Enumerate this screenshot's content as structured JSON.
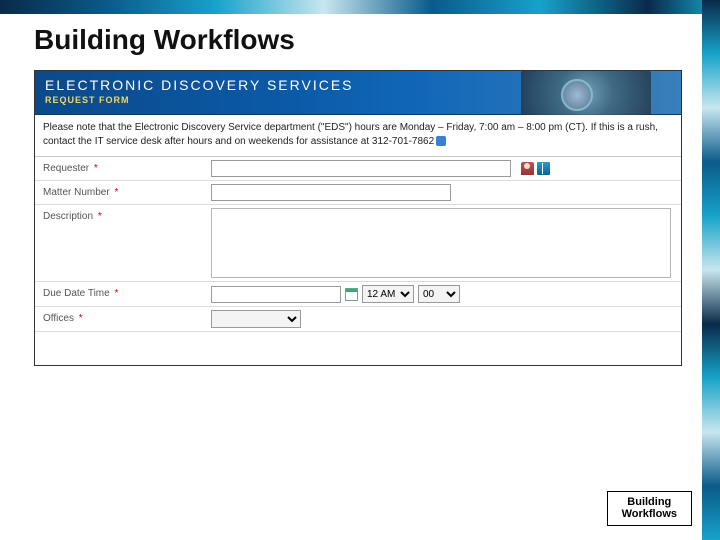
{
  "slide": {
    "title": "Building Workflows",
    "footer_label": "Building\nWorkflows"
  },
  "banner": {
    "title": "ELECTRONIC DISCOVERY SERVICES",
    "subtitle": "REQUEST FORM"
  },
  "notice": {
    "text": "Please note that the Electronic Discovery Service department (\"EDS\") hours are Monday – Friday, 7:00 am – 8:00 pm (CT). If this is a rush, contact the IT service desk after hours and on weekends for assistance at 312-701-7862"
  },
  "fields": {
    "requester": {
      "label": "Requester",
      "required": "*",
      "value": ""
    },
    "matter_number": {
      "label": "Matter Number",
      "required": "*",
      "value": ""
    },
    "description": {
      "label": "Description",
      "required": "*",
      "value": ""
    },
    "due_date_time": {
      "label": "Due Date Time",
      "required": "*",
      "value": "",
      "hour": "12 AM",
      "minute": "00"
    },
    "offices": {
      "label": "Offices",
      "required": "*",
      "value": ""
    }
  },
  "icons": {
    "person_picker": "person-check-icon",
    "address_book": "address-book-icon",
    "calendar": "calendar-icon",
    "link": "link-icon"
  }
}
